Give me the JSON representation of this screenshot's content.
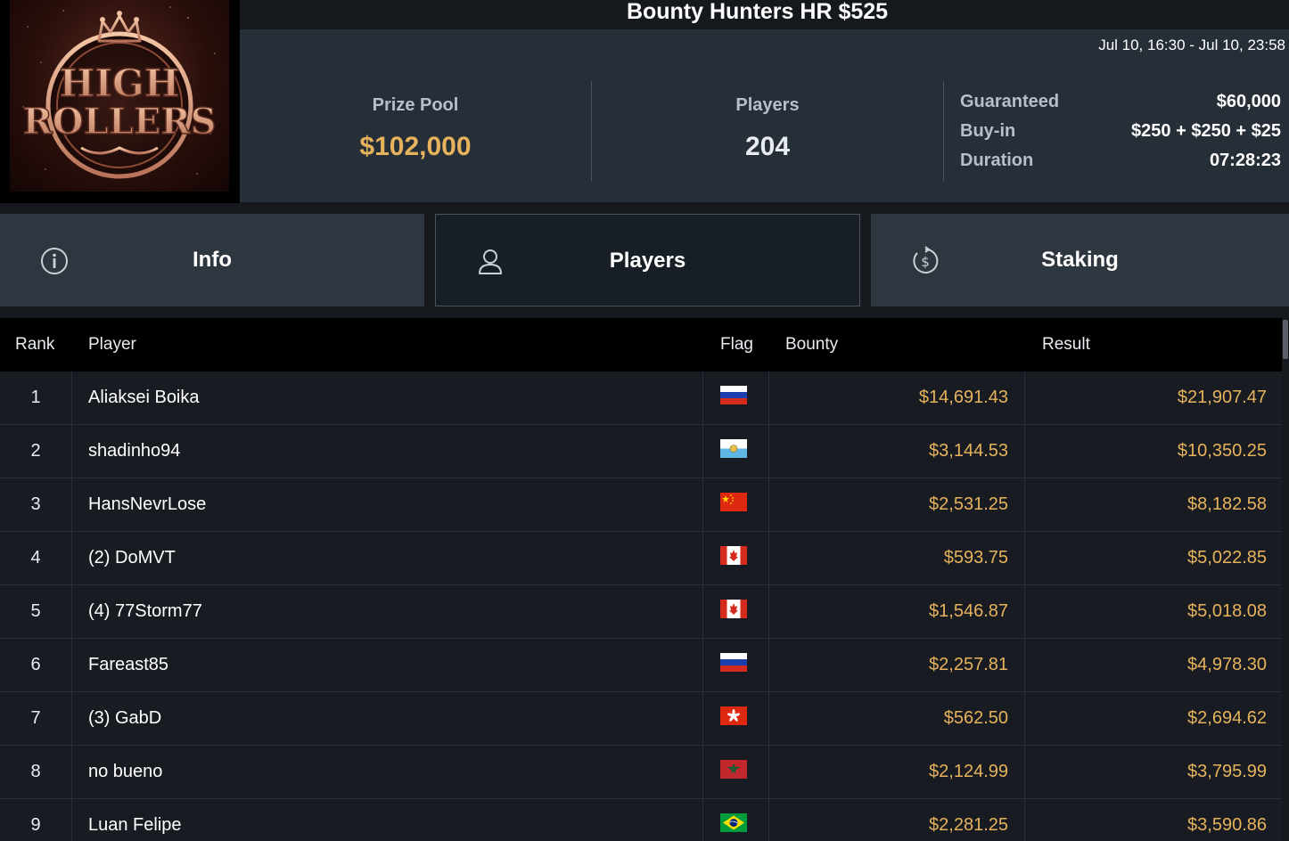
{
  "logo": {
    "text_line1": "HIGH",
    "text_line2": "ROLLERS"
  },
  "header": {
    "title": "Bounty Hunters HR $525",
    "date_range": "Jul 10, 16:30 - Jul 10, 23:58"
  },
  "stats": {
    "prize_pool_label": "Prize Pool",
    "prize_pool_value": "$102,000",
    "players_label": "Players",
    "players_value": "204",
    "details": [
      {
        "label": "Guaranteed",
        "value": "$60,000"
      },
      {
        "label": "Buy-in",
        "value": "$250 + $250 + $25"
      },
      {
        "label": "Duration",
        "value": "07:28:23"
      }
    ]
  },
  "tabs": [
    {
      "label": "Info",
      "icon": "info-icon",
      "active": false
    },
    {
      "label": "Players",
      "icon": "user-icon",
      "active": true
    },
    {
      "label": "Staking",
      "icon": "dollar-cycle-icon",
      "active": false
    }
  ],
  "table": {
    "headers": {
      "rank": "Rank",
      "player": "Player",
      "flag": "Flag",
      "bounty": "Bounty",
      "result": "Result"
    },
    "rows": [
      {
        "rank": "1",
        "player": "Aliaksei Boika",
        "flag": "russia",
        "bounty": "$14,691.43",
        "result": "$21,907.47"
      },
      {
        "rank": "2",
        "player": "shadinho94",
        "flag": "san-marino",
        "bounty": "$3,144.53",
        "result": "$10,350.25"
      },
      {
        "rank": "3",
        "player": "HansNevrLose",
        "flag": "china",
        "bounty": "$2,531.25",
        "result": "$8,182.58"
      },
      {
        "rank": "4",
        "player": "(2) DoMVT",
        "flag": "canada",
        "bounty": "$593.75",
        "result": "$5,022.85"
      },
      {
        "rank": "5",
        "player": "(4) 77Storm77",
        "flag": "canada",
        "bounty": "$1,546.87",
        "result": "$5,018.08"
      },
      {
        "rank": "6",
        "player": "Fareast85",
        "flag": "russia",
        "bounty": "$2,257.81",
        "result": "$4,978.30"
      },
      {
        "rank": "7",
        "player": "(3) GabD",
        "flag": "hong-kong",
        "bounty": "$562.50",
        "result": "$2,694.62"
      },
      {
        "rank": "8",
        "player": "no bueno",
        "flag": "morocco",
        "bounty": "$2,124.99",
        "result": "$3,795.99"
      },
      {
        "rank": "9",
        "player": "Luan Felipe",
        "flag": "brazil",
        "bounty": "$2,281.25",
        "result": "$3,590.86"
      }
    ]
  },
  "colors": {
    "accent_gold": "#e6b35c",
    "panel": "#262e38",
    "tab": "#2e3640",
    "tab_active": "#181e26"
  }
}
